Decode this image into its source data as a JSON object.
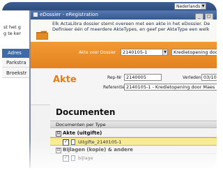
{
  "language": {
    "selected": "Nederlands"
  },
  "window": {
    "title": "eDossier - eRegistration"
  },
  "background_app": {
    "text_lines": [
      "st het g",
      "g te ker"
    ],
    "header": "Adres",
    "rows": [
      "Parkstra",
      "Broekstr"
    ]
  },
  "intro": {
    "line1": "Elk ActaLibra dossier stemt overeen met een akte in het eDossier. De",
    "line2": "Definieer één of meerdere AkteTypes, en geef per AkteType een welk"
  },
  "dossier_bar": {
    "label": "Akte voor Dossier",
    "value": "2140105-1",
    "value2": "Kredietopening door M"
  },
  "akte": {
    "title": "Akte",
    "rep_nr_label": "Rep-Nr",
    "rep_nr_value": "2140005",
    "verleden_label": "Verleden",
    "verleden_value": "03/10/2",
    "referentie_label": "Referentie",
    "referentie_value": "2140105-1 - Kredietopening door Maes"
  },
  "documents": {
    "title": "Documenten",
    "column_header": "Documenten per Type",
    "groups": [
      {
        "toggle": "⊟",
        "label": "Akte (uitgifte)",
        "items": [
          "Uitgifte_2140105-1"
        ]
      },
      {
        "toggle": "⊟",
        "label": "Bijlagen (kopie) & andere",
        "items": [
          "bijlage"
        ]
      }
    ]
  },
  "colors": {
    "orange": "#e4821e",
    "navy": "#36598f",
    "selected_row": "#f7e98d"
  }
}
